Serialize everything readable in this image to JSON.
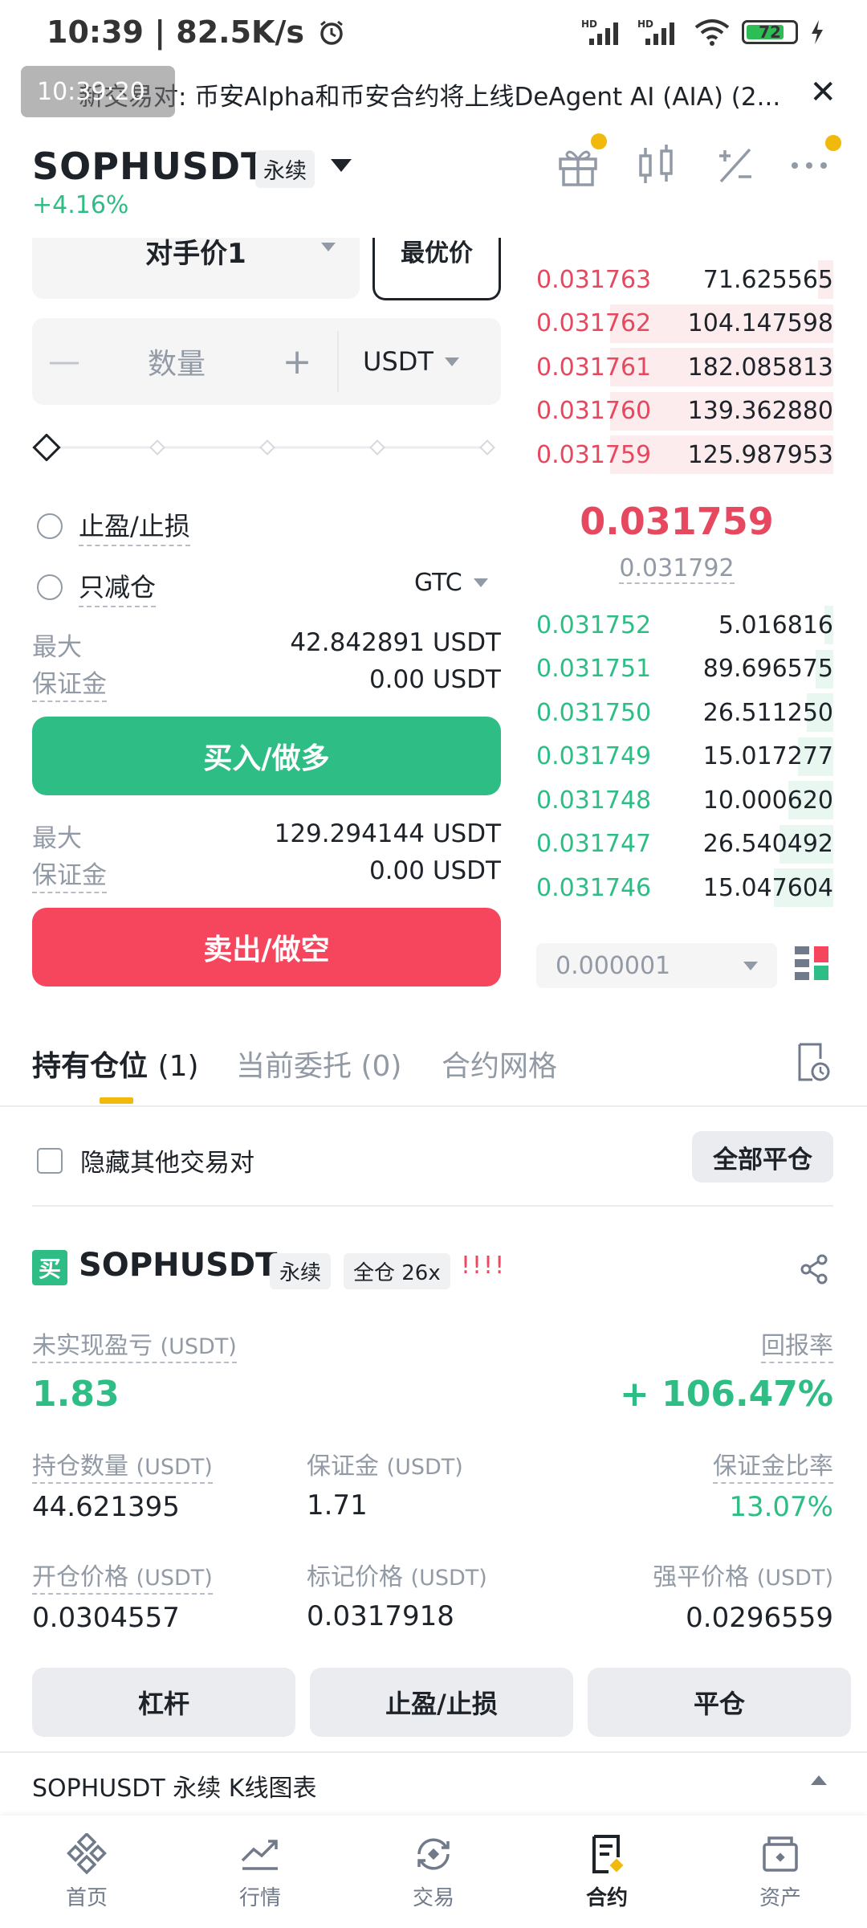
{
  "status_bar": {
    "time": "10:39 | 82.5K/s",
    "battery": "72"
  },
  "notice": {
    "overlay": "10:39:20",
    "text": "新交易对: 币安Alpha和币安合约将上线DeAgent AI (AIA) (2..."
  },
  "header": {
    "symbol": "SOPHUSDT",
    "tag": "永续",
    "change": "+4.16%"
  },
  "order_form": {
    "price_type": "对手价1",
    "best_price": "最优价",
    "qty_minus": "—",
    "qty_label": "数量",
    "qty_plus": "+",
    "qty_unit": "USDT",
    "tp_sl": "止盈/止损",
    "reduce_only": "只减仓",
    "tif": "GTC",
    "buy_max_label": "最大",
    "buy_max_value": "42.842891 USDT",
    "buy_margin_label": "保证金",
    "buy_margin_value": "0.00 USDT",
    "buy_button": "买入/做多",
    "sell_max_label": "最大",
    "sell_max_value": "129.294144 USDT",
    "sell_margin_label": "保证金",
    "sell_margin_value": "0.00 USDT",
    "sell_button": "卖出/做空"
  },
  "order_book": {
    "asks": [
      {
        "price": "0.031763",
        "qty": "71.625565",
        "depth": 0.05
      },
      {
        "price": "0.031762",
        "qty": "104.147598",
        "depth": 0.75
      },
      {
        "price": "0.031761",
        "qty": "182.085813",
        "depth": 0.75
      },
      {
        "price": "0.031760",
        "qty": "139.362880",
        "depth": 0.75
      },
      {
        "price": "0.031759",
        "qty": "125.987953",
        "depth": 0.75
      }
    ],
    "last_price": "0.031759",
    "mark_price": "0.031792",
    "bids": [
      {
        "price": "0.031752",
        "qty": "5.016816",
        "depth": 0.03
      },
      {
        "price": "0.031751",
        "qty": "89.696575",
        "depth": 0.06
      },
      {
        "price": "0.031750",
        "qty": "26.511250",
        "depth": 0.09
      },
      {
        "price": "0.031749",
        "qty": "15.017277",
        "depth": 0.12
      },
      {
        "price": "0.031748",
        "qty": "10.000620",
        "depth": 0.15
      },
      {
        "price": "0.031747",
        "qty": "26.540492",
        "depth": 0.18
      },
      {
        "price": "0.031746",
        "qty": "15.047604",
        "depth": 0.2
      }
    ],
    "precision": "0.000001"
  },
  "tabs": {
    "positions": "持有仓位",
    "positions_count": "(1)",
    "orders": "当前委托 (0)",
    "grid": "合约网格"
  },
  "controls": {
    "hide_others": "隐藏其他交易对",
    "close_all": "全部平仓"
  },
  "position": {
    "side": "买",
    "symbol": "SOPHUSDT",
    "tag": "永续",
    "mode": "全仓 26x",
    "warning": "!!!!",
    "pnl_label": "未实现盈亏",
    "unit": "(USDT)",
    "pnl_value": "1.83",
    "roe_label": "回报率",
    "roe_value": "+ 106.47%",
    "size_label": "持仓数量",
    "size_value": "44.621395",
    "margin_label": "保证金",
    "margin_value": "1.71",
    "margin_ratio_label": "保证金比率",
    "margin_ratio_value": "13.07%",
    "entry_label": "开仓价格",
    "entry_value": "0.0304557",
    "mark_label": "标记价格",
    "mark_value": "0.0317918",
    "liq_label": "强平价格",
    "liq_value": "0.0296559",
    "btn_leverage": "杠杆",
    "btn_tpsl": "止盈/止损",
    "btn_close": "平仓"
  },
  "kline": {
    "label": "SOPHUSDT 永续 K线图表"
  },
  "nav": {
    "home": "首页",
    "markets": "行情",
    "trade": "交易",
    "futures": "合约",
    "assets": "资产"
  },
  "colors": {
    "green": "#2ebd85",
    "red": "#f6465d",
    "accent": "#f0b90b"
  }
}
